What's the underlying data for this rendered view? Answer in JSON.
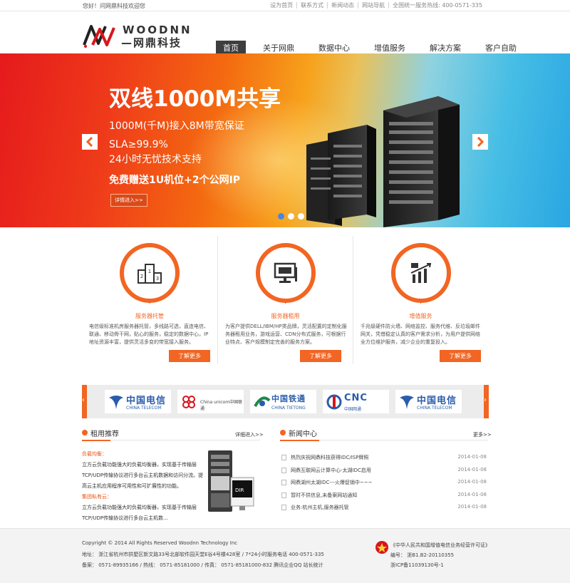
{
  "topbar": {
    "welcome": "您好！问网鼎科技欢迎您",
    "links": [
      "设为首页",
      "联系方式",
      "新闻动态",
      "网站导航",
      "全国统一服务热线: 400-0571-335"
    ]
  },
  "logo": {
    "brand": "WOODNN",
    "cn": "—网鼎科技—"
  },
  "nav": [
    "首页",
    "关于网鼎",
    "数据中心",
    "增值服务",
    "解决方案",
    "客户自助"
  ],
  "banner": {
    "headline": "双线1000M共享",
    "line1": "1000M(千M)接入8M带宽保证",
    "line2": "SLA≥99.9%",
    "line3": "24小时无忧技术支持",
    "line4": "免费赠送1U机位+2个公网IP",
    "button": "详情进入>>",
    "slide_index": 1,
    "slide_count": 3
  },
  "services": [
    {
      "icon": "podium-icon",
      "title": "服务器托管",
      "desc": "电信级标准机房服务器托管，多线路可选，直连电信、联通、移动骨干网，贴心的服务，稳定的数据中心，IP地址资源丰富，提供灵活多变的带宽接入服务。",
      "more": "了解更多"
    },
    {
      "icon": "monitor-icon",
      "title": "服务器租用",
      "desc": "为客户提供DELL/IBM/HP类品牌，灵活配置的定制化服务器租用业务，游戏运营、CDN分布式服务，可根据行业特点、客户规模制定完善的服务方案。",
      "more": "了解更多"
    },
    {
      "icon": "growth-chart-icon",
      "title": "增值服务",
      "desc": "千兆级硬件防火墙、网络监控、服务代维、反垃圾邮件网关，凭借稳定认真的客户需求分析，为用户提供网络全方位维护服务，减少企业的重复投入。",
      "more": "了解更多"
    }
  ],
  "partners": [
    {
      "name": "中国电信",
      "sub": "CHINA TELECOM"
    },
    {
      "name": "China unicom中国联通",
      "sub": ""
    },
    {
      "name": "中国铁通",
      "sub": "CHINA TIETONG"
    },
    {
      "name": "CNC",
      "sub": "中国网通"
    },
    {
      "name": "中国电信",
      "sub": "CHINA TELECOM"
    }
  ],
  "rent": {
    "title": "租用推荐",
    "more": "详细进入>>",
    "lines": [
      {
        "text": "负载均衡：",
        "hl": true
      },
      {
        "text": "立方云负载功能强大的负载均衡器，实现基于传输层",
        "hl": false
      },
      {
        "text": "TCP/UDP传输协议进行多台云主机数据和访问分流。提",
        "hl": false
      },
      {
        "text": "高云主机应用程序可用性和可扩展性的功能。",
        "hl": false
      },
      {
        "text": "集团私有云：",
        "hl": true
      },
      {
        "text": "立方云负载功能强大的负载均衡器，实现基于传输层",
        "hl": false
      },
      {
        "text": "TCP/UDP传输协议进行多台云主机数...",
        "hl": false
      }
    ],
    "product_label": "DIR"
  },
  "news": {
    "title": "新闻中心",
    "more": "更多>>",
    "items": [
      {
        "title": "热烈庆祝网鼎科技获得IDC/ISP牌照",
        "date": "2014-01-08"
      },
      {
        "title": "网鼎互联网云计算中心-太湖IDC启用",
        "date": "2014-01-08"
      },
      {
        "title": "网鼎湖州太湖IDC---火爆促销中~~~",
        "date": "2014-01-08"
      },
      {
        "title": "暂时不供信息,未备案网站通知",
        "date": "2014-01-08"
      },
      {
        "title": "业务:杭州主机,服务器托管",
        "date": "2014-01-08"
      }
    ]
  },
  "footer": {
    "copyright": "Copyright © 2014 All Rights Reserved Woodnn Technology Inc",
    "address": "地址：  浙江省杭州市拱墅区新文路33号北部软件园天堂E谷4号楼428室 / 7*24小时服务电话 400-0571-335",
    "contact": "备案：  0571-89935166 / 热线：   0571-85181000 / 传真：  0571-85181000-832 腾讯企业QQ 站长统计",
    "license_title": "《中华人民共和国增值电信业务经营许可证》",
    "license_no": "编号：  浙B1.B2-20110355",
    "icp": "浙ICP备11039130号-1"
  },
  "colors": {
    "accent": "#f26522",
    "nav_active": "#3e3e3e"
  }
}
